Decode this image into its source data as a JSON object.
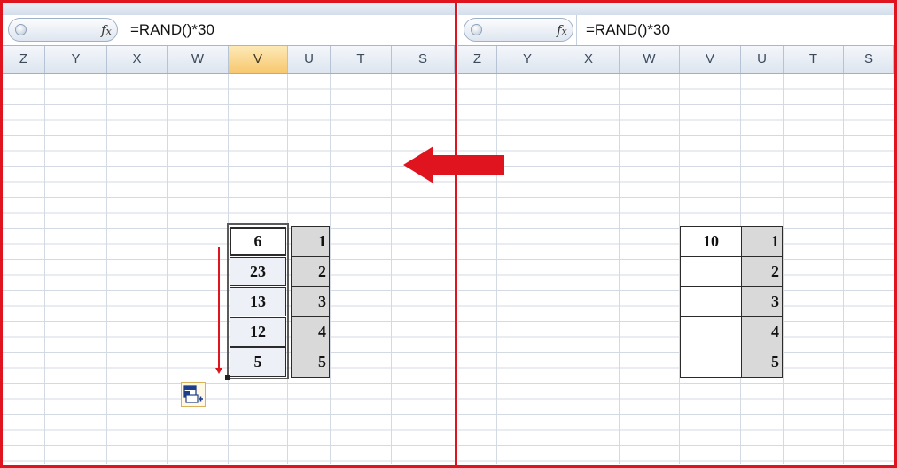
{
  "formula_bar": {
    "fx_label": "fx",
    "formula": "=RAND()*30"
  },
  "columns": [
    "Z",
    "Y",
    "X",
    "W",
    "V",
    "U",
    "T",
    "S"
  ],
  "left_panel": {
    "active_column": "V",
    "v_values": [
      "6",
      "23",
      "13",
      "12",
      "5"
    ],
    "u_values": [
      "1",
      "2",
      "3",
      "4",
      "5"
    ]
  },
  "right_panel": {
    "v_values": [
      "10",
      "",
      "",
      "",
      ""
    ],
    "u_values": [
      "1",
      "2",
      "3",
      "4",
      "5"
    ]
  },
  "icons": {
    "autofill_options": "auto-fill-options-icon",
    "transition_arrow": "left-arrow-icon",
    "name_box_button": "name-box-dropdown-icon",
    "function_icon": "fx-icon"
  },
  "colors": {
    "frame": "#e0141e",
    "arrow": "#e0141e",
    "active_header": "#f7c870",
    "u_fill": "#d9d9d9"
  }
}
